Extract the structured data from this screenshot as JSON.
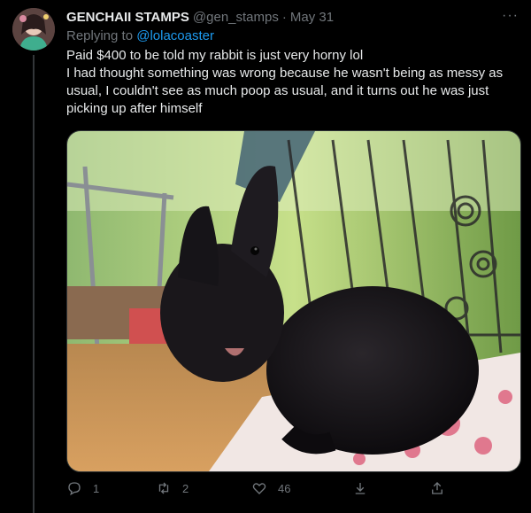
{
  "tweet": {
    "author_name": "GENCHAII STAMPS",
    "author_handle": "@gen_stamps",
    "separator": "·",
    "date": "May 31",
    "reply_prefix": "Replying to",
    "reply_to": "@lolacoaster",
    "text_line1": "Paid $400 to be told my rabbit is just very horny lol",
    "text_line2": "I had thought something was wrong because he wasn't being as messy as usual, I couldn't see as much poop as usual, and it turns out he was just picking up after himself",
    "more_label": "···"
  },
  "actions": {
    "reply_count": "1",
    "retweet_count": "2",
    "like_count": "46"
  },
  "icons": {
    "reply": "reply-bubble-icon",
    "retweet": "retweet-icon",
    "like": "heart-icon",
    "download": "download-arrow-icon",
    "share": "share-icon",
    "more": "more-dots-icon"
  },
  "colors": {
    "background": "#000000",
    "text": "#e7e9ea",
    "muted": "#71767b",
    "link": "#1d9bf0"
  }
}
